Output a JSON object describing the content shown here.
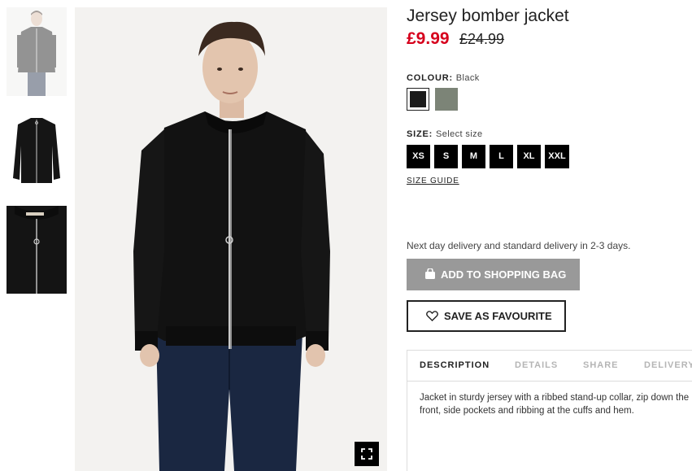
{
  "product": {
    "title": "Jersey bomber jacket",
    "price_now": "£9.99",
    "price_old": "£24.99"
  },
  "colour": {
    "label": "COLOUR:",
    "value": "Black",
    "swatches": [
      {
        "name": "Black",
        "color": "#1b1b1b",
        "selected": true
      },
      {
        "name": "Khaki green",
        "color": "#7c8477",
        "selected": false
      }
    ]
  },
  "size": {
    "label": "SIZE:",
    "value": "Select size",
    "options": [
      "XS",
      "S",
      "M",
      "L",
      "XL",
      "XXL"
    ],
    "guide": "SIZE GUIDE"
  },
  "delivery_text": "Next day delivery and standard delivery in 2-3 days.",
  "actions": {
    "add_to_bag": "ADD TO SHOPPING BAG",
    "save_favourite": "SAVE AS FAVOURITE"
  },
  "tabs": [
    "DESCRIPTION",
    "DETAILS",
    "SHARE",
    "DELIVERY"
  ],
  "description": "Jacket in sturdy jersey with a ribbed stand-up collar, zip down the front, side pockets and ribbing at the cuffs and hem.",
  "colors": {
    "sale_red": "#d6001c",
    "button_gray": "#999999",
    "size_black": "#000000"
  },
  "icons": {
    "add_to_bag": "shopping-bag-icon",
    "favourite": "heart-icon",
    "fullscreen": "expand-icon"
  }
}
